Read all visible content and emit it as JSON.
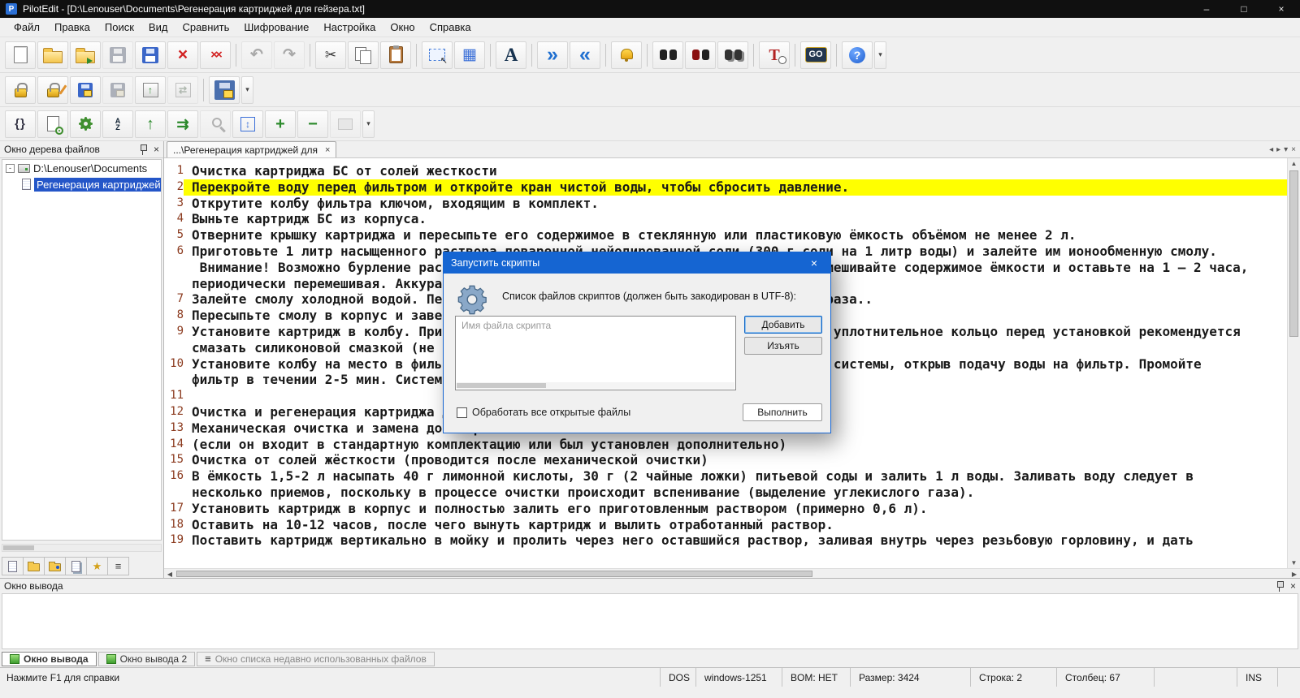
{
  "window": {
    "app_icon": "P",
    "title": "PilotEdit - [D:\\Lenouser\\Documents\\Регенерация картриджей для гейзера.txt]",
    "controls": {
      "minimize": "–",
      "maximize": "□",
      "close": "×"
    }
  },
  "menu": [
    "Файл",
    "Правка",
    "Поиск",
    "Вид",
    "Сравнить",
    "Шифрование",
    "Настройка",
    "Окно",
    "Справка"
  ],
  "toolbar1": [
    {
      "n": "new-file",
      "k": "page"
    },
    {
      "n": "open-file",
      "k": "folder"
    },
    {
      "n": "open-remote-file",
      "k": "folder fa"
    },
    {
      "n": "save-file",
      "k": "floppy",
      "d": 1
    },
    {
      "n": "save-all",
      "k": "floppy"
    },
    {
      "n": "close-file",
      "k": "xred",
      "g": "×"
    },
    {
      "n": "close-all-files",
      "k": "xred xall",
      "g": "××"
    },
    {
      "n": "undo",
      "k": "arr",
      "g": "↶",
      "d": 1,
      "s": 1
    },
    {
      "n": "redo",
      "k": "arr",
      "g": "↷",
      "d": 1
    },
    {
      "n": "cut",
      "k": "cut",
      "g": "✂",
      "s": 1
    },
    {
      "n": "copy",
      "k": "copy"
    },
    {
      "n": "paste",
      "k": "paste"
    },
    {
      "n": "select-mode",
      "k": "selbox",
      "s": 1
    },
    {
      "n": "column-mode",
      "k": "grid",
      "g": "▦"
    },
    {
      "n": "font",
      "k": "fontA",
      "g": "A",
      "s": 1
    },
    {
      "n": "go-forward",
      "k": "chev",
      "g": "»",
      "s": 1
    },
    {
      "n": "go-back",
      "k": "chev",
      "g": "«"
    },
    {
      "n": "reminder",
      "k": "bell",
      "s": 1
    },
    {
      "n": "find",
      "k": "binoc",
      "s": 1
    },
    {
      "n": "find-replace",
      "k": "binoc rep"
    },
    {
      "n": "find-in-files",
      "k": "binoc multi"
    },
    {
      "n": "replace-in-files",
      "k": "tclock",
      "g": "T",
      "s": 1
    },
    {
      "n": "goto",
      "k": "go",
      "g": "GO",
      "s": 1
    },
    {
      "n": "help",
      "k": "help",
      "g": "?",
      "s": 1
    },
    {
      "n": "help-menu",
      "k": "drop",
      "g": "▾"
    }
  ],
  "toolbar2": [
    {
      "n": "encrypt-file",
      "k": "lock"
    },
    {
      "n": "decrypt-file",
      "k": "lock pen"
    },
    {
      "n": "save-encrypted",
      "k": "floppylock"
    },
    {
      "n": "save-encrypted-as",
      "k": "floppylock",
      "d": 1
    },
    {
      "n": "upload-to-ftp",
      "k": "upbox",
      "g": "↑"
    },
    {
      "n": "transfer-files",
      "k": "upbox",
      "g": "⇄",
      "d": 1
    },
    {
      "n": "open-encrypted-file",
      "k": "bigfloppylock",
      "s": 1
    },
    {
      "n": "encryption-menu",
      "k": "drop",
      "g": "▾"
    }
  ],
  "toolbar3": [
    {
      "n": "edit-script",
      "k": "braces",
      "g": "{}"
    },
    {
      "n": "script-file",
      "k": "pagegear"
    },
    {
      "n": "run-script",
      "k": "gearc"
    },
    {
      "n": "sort-lines",
      "k": "sortaz",
      "g": "A\nZ"
    },
    {
      "n": "move-to-top",
      "k": "uparr",
      "g": "↑"
    },
    {
      "n": "goto-position",
      "k": "gotoarr",
      "g": "⇉"
    },
    {
      "n": "find-symbol",
      "k": "magn",
      "d": 1
    },
    {
      "n": "fit-window",
      "k": "fitbox",
      "g": "↕"
    },
    {
      "n": "zoom-in",
      "k": "plus",
      "g": "+"
    },
    {
      "n": "zoom-out",
      "k": "minus",
      "g": "−"
    },
    {
      "n": "extra-tool",
      "k": "boxgray",
      "d": 1
    },
    {
      "n": "scripts-menu",
      "k": "drop",
      "g": "▾"
    }
  ],
  "tree": {
    "header": "Окно дерева файлов",
    "expander": "-",
    "root_label": "D:\\Lenouser\\Documents",
    "file_label": "Регенерация картриджей для гейзера.txt",
    "close": "×"
  },
  "tree_tabs": [
    {
      "n": "tree-tab-file",
      "k": "mi-doc"
    },
    {
      "n": "tree-tab-folder",
      "k": "mi-folder"
    },
    {
      "n": "tree-tab-search",
      "k": "mi-folder dot"
    },
    {
      "n": "tree-tab-project",
      "k": "mi-doc lines"
    },
    {
      "n": "tree-tab-favorites",
      "k": "mi-star",
      "g": "★"
    },
    {
      "n": "tree-tab-list",
      "k": "mi-list",
      "g": "≡"
    }
  ],
  "tabbar": {
    "active_tab": "...\\Регенерация картриджей для",
    "close": "×",
    "scroll_left": "◂",
    "scroll_right": "▸",
    "menu": "▾",
    "close_all": "×"
  },
  "scrollbars": {
    "up": "▲",
    "down": "▼",
    "left": "◀",
    "right": "▶"
  },
  "editor": {
    "rows": [
      {
        "n": "1",
        "t": "Очистка картриджа БС от солей жесткости"
      },
      {
        "n": "2",
        "t": "Перекройте воду перед фильтром и откройте кран чистой воды, чтобы сбросить давление.",
        "hl": true
      },
      {
        "n": "3",
        "t": "Открутите колбу фильтра ключом, входящим в комплект."
      },
      {
        "n": "4",
        "t": "Выньте картридж БС из корпуса."
      },
      {
        "n": "5",
        "t": "Отверните крышку картриджа и пересыпьте его содержимое в стеклянную или пластиковую ёмкость объёмом не менее 2 л."
      },
      {
        "n": "6",
        "t": "Приготовьте 1 литр насыщенного раствора поваренной нейодированной соли (300 г соли на 1 литр воды) и залейте им ионообменную смолу."
      },
      {
        "n": "",
        "t": " Внимание! Возможно бурление раствора с обильным выделением тепла. Тщательно перемешивайте содержимое ёмкости и оставьте на 1 – 2 часа,"
      },
      {
        "n": "",
        "t": "периодически перемешивая. Аккуратно слейте отработанный раствор."
      },
      {
        "n": "7",
        "t": "Залейте смолу холодной водой. Перемешайте, после чего слейте воду. Повторите два раза.."
      },
      {
        "n": "8",
        "t": "Пересыпьте смолу в корпус и заверните крышку картриджа."
      },
      {
        "n": "9",
        "t": "Установите картридж в колбу. При повторной сборке обязательно проверьте резиновое уплотнительное кольцо перед установкой рекомендуется"
      },
      {
        "n": "",
        "t": "смазать силиконовой смазкой (не содержащей минеральных масел и растворителей)."
      },
      {
        "n": "10",
        "t": "Установите колбу на место в фильтре и плотно затяните ключом. Восстановите работу системы, открыв подачу воды на фильтр. Промойте"
      },
      {
        "n": "",
        "t": "фильтр в течении 2-5 мин. Система готова к работе."
      },
      {
        "n": "11",
        "t": ""
      },
      {
        "n": "12",
        "t": "Очистка и регенерация картриджа для гейзера"
      },
      {
        "n": "13",
        "t": "Механическая очистка и замена дозатора"
      },
      {
        "n": "14",
        "t": "(если он входит в стандартную комплектацию или был установлен дополнительно)"
      },
      {
        "n": "15",
        "t": "Очистка от солей жёсткости (проводится после механической очистки)"
      },
      {
        "n": "16",
        "t": "В ёмкость 1,5-2 л насыпать 40 г лимонной кислоты, 30 г (2 чайные ложки) питьевой соды и залить 1 л воды. Заливать воду следует в"
      },
      {
        "n": "",
        "t": "несколько приемов, поскольку в процессе очистки происходит вспенивание (выделение углекислого газа)."
      },
      {
        "n": "17",
        "t": "Установить картридж в корпус и полностью залить его приготовленным раствором (примерно 0,6 л)."
      },
      {
        "n": "18",
        "t": "Оставить на 10-12 часов, после чего вынуть картридж и вылить отработанный раствор."
      },
      {
        "n": "19",
        "t": "Поставить картридж вертикально в мойку и пролить через него оставшийся раствор, заливая внутрь через резьбовую горловину, и дать"
      }
    ]
  },
  "dialog": {
    "title": "Запустить скрипты",
    "close": "×",
    "label": "Список файлов скриптов (должен быть закодирован в UTF-8):",
    "list_header": "Имя файла скрипта",
    "add": "Добавить",
    "remove": "Изъять",
    "run": "Выполнить",
    "checkbox_label": "Обработать все открытые файлы",
    "checkbox_checked": false
  },
  "output": {
    "header": "Окно вывода",
    "close": "×",
    "tabs": [
      {
        "label": "Окно вывода",
        "active": true,
        "k": "mi-grid"
      },
      {
        "label": "Окно вывода 2",
        "active": false,
        "k": "mi-grid"
      },
      {
        "label": "Окно списка недавно использованных файлов",
        "active": false,
        "muted": true,
        "k": "mi-list",
        "g": "≡"
      }
    ]
  },
  "status": {
    "help": "Нажмите F1 для справки",
    "segments": [
      "DOS",
      "windows-1251",
      "BOM: НЕТ",
      "Размер: 3424",
      "Строка: 2",
      "Столбец: 67",
      "",
      "INS",
      ""
    ]
  },
  "colors": {
    "accent": "#1565d2",
    "selection": "#2456c8",
    "line_highlight": "#ffff00",
    "titlebar_bg": "#101010",
    "chrome_bg": "#f0f0f0",
    "line_number": "#8b3a1e"
  }
}
